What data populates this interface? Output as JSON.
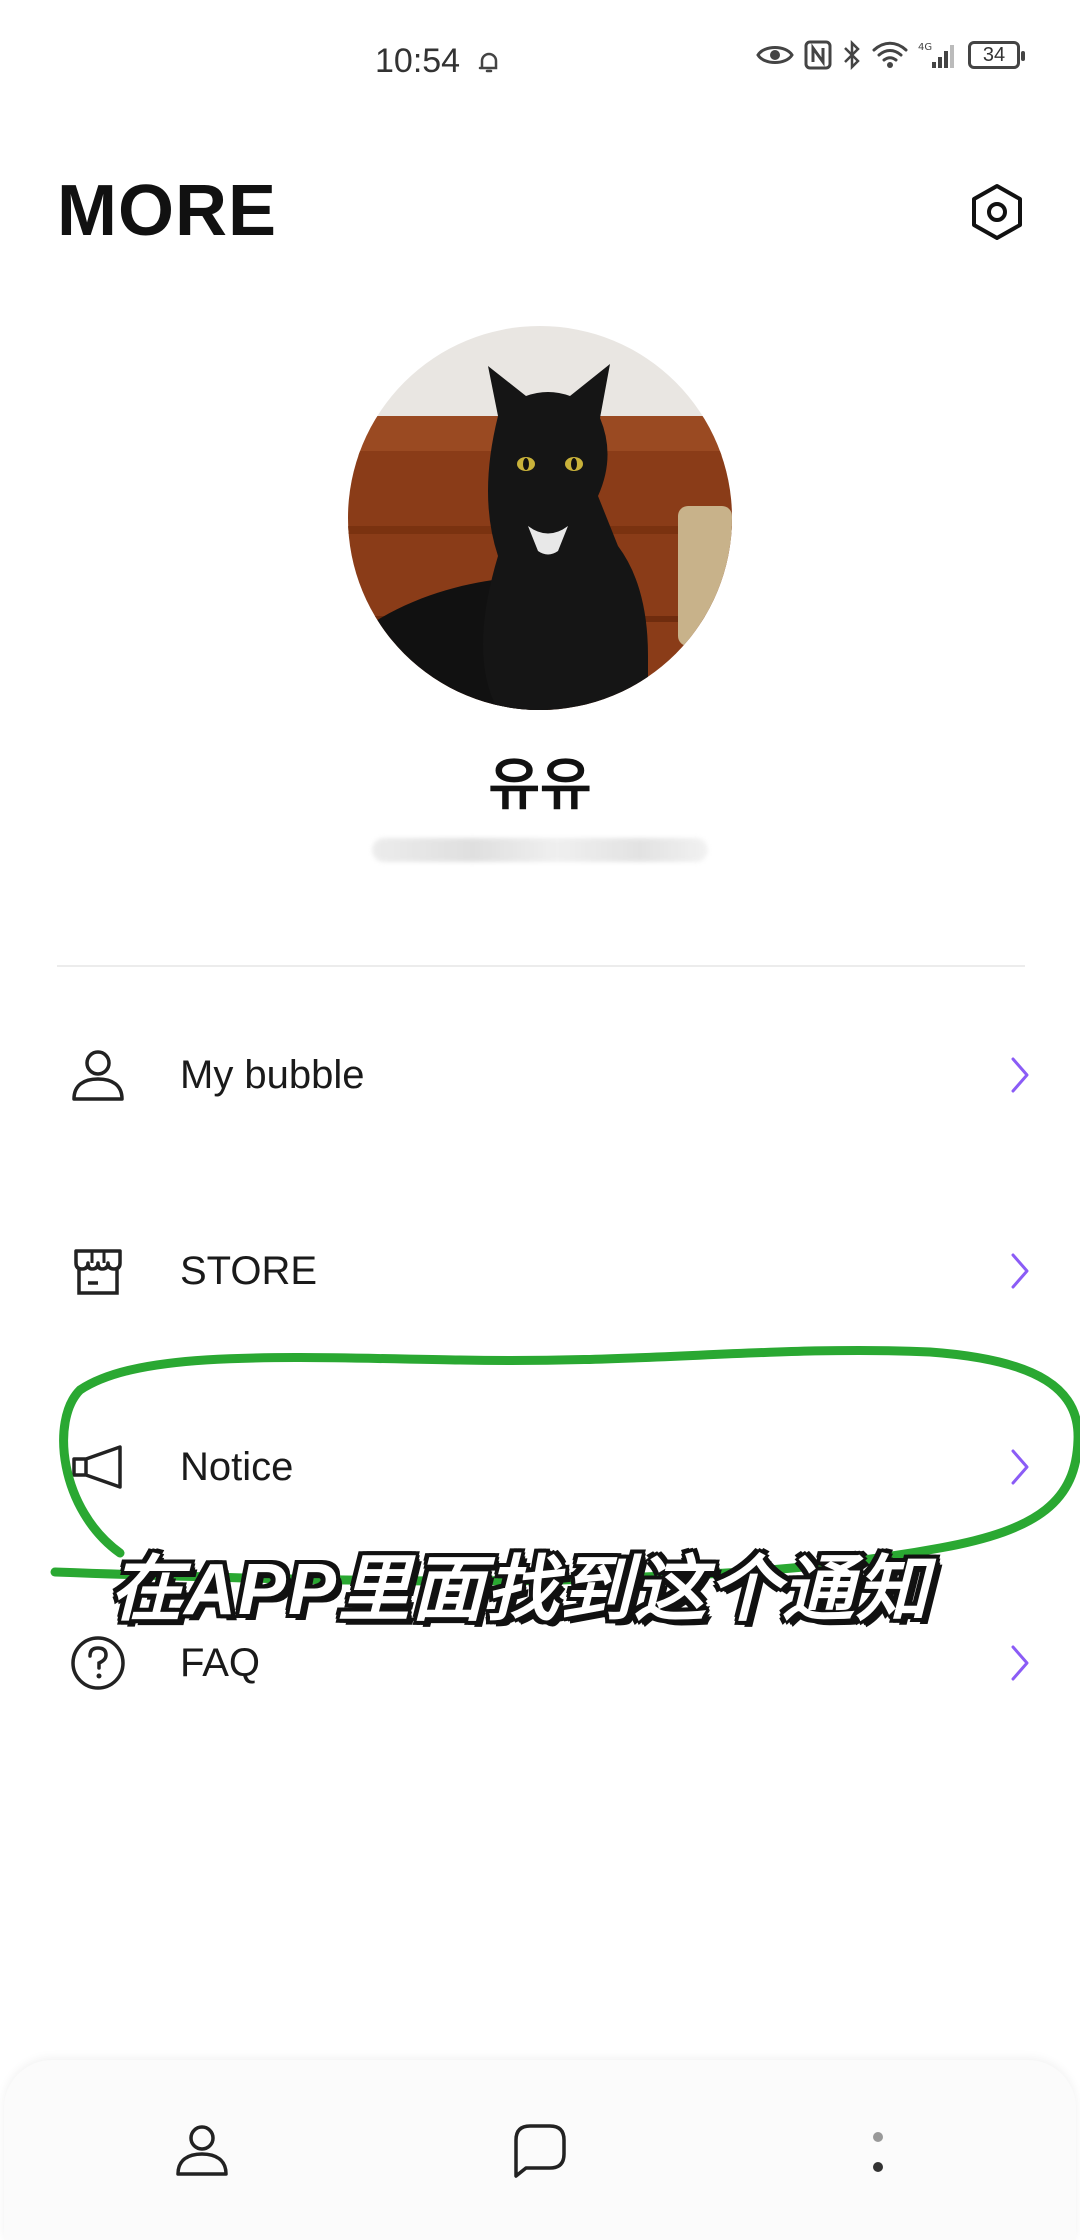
{
  "status_bar": {
    "time": "10:54",
    "battery": "34",
    "icons": [
      "bell-icon",
      "eye-icon",
      "nfc-icon",
      "bluetooth-icon",
      "wifi-icon",
      "signal-4g-icon",
      "battery-icon"
    ]
  },
  "header": {
    "title": "MORE",
    "settings_icon": "settings-hexagon-icon"
  },
  "profile": {
    "name": "유유",
    "subtitle_blurred": true
  },
  "menu": {
    "items": [
      {
        "label": "My bubble",
        "icon": "person-icon"
      },
      {
        "label": "STORE",
        "icon": "store-icon"
      },
      {
        "label": "Notice",
        "icon": "megaphone-icon"
      },
      {
        "label": "FAQ",
        "icon": "question-circle-icon"
      }
    ],
    "chevron_color": "#8b5cf6"
  },
  "overlay": {
    "caption": "在APP里面找到这个通知",
    "highlight_color": "#2aa832"
  },
  "bottom_nav": {
    "items": [
      "profile-tab-icon",
      "chat-tab-icon",
      "more-tab-icon"
    ]
  }
}
